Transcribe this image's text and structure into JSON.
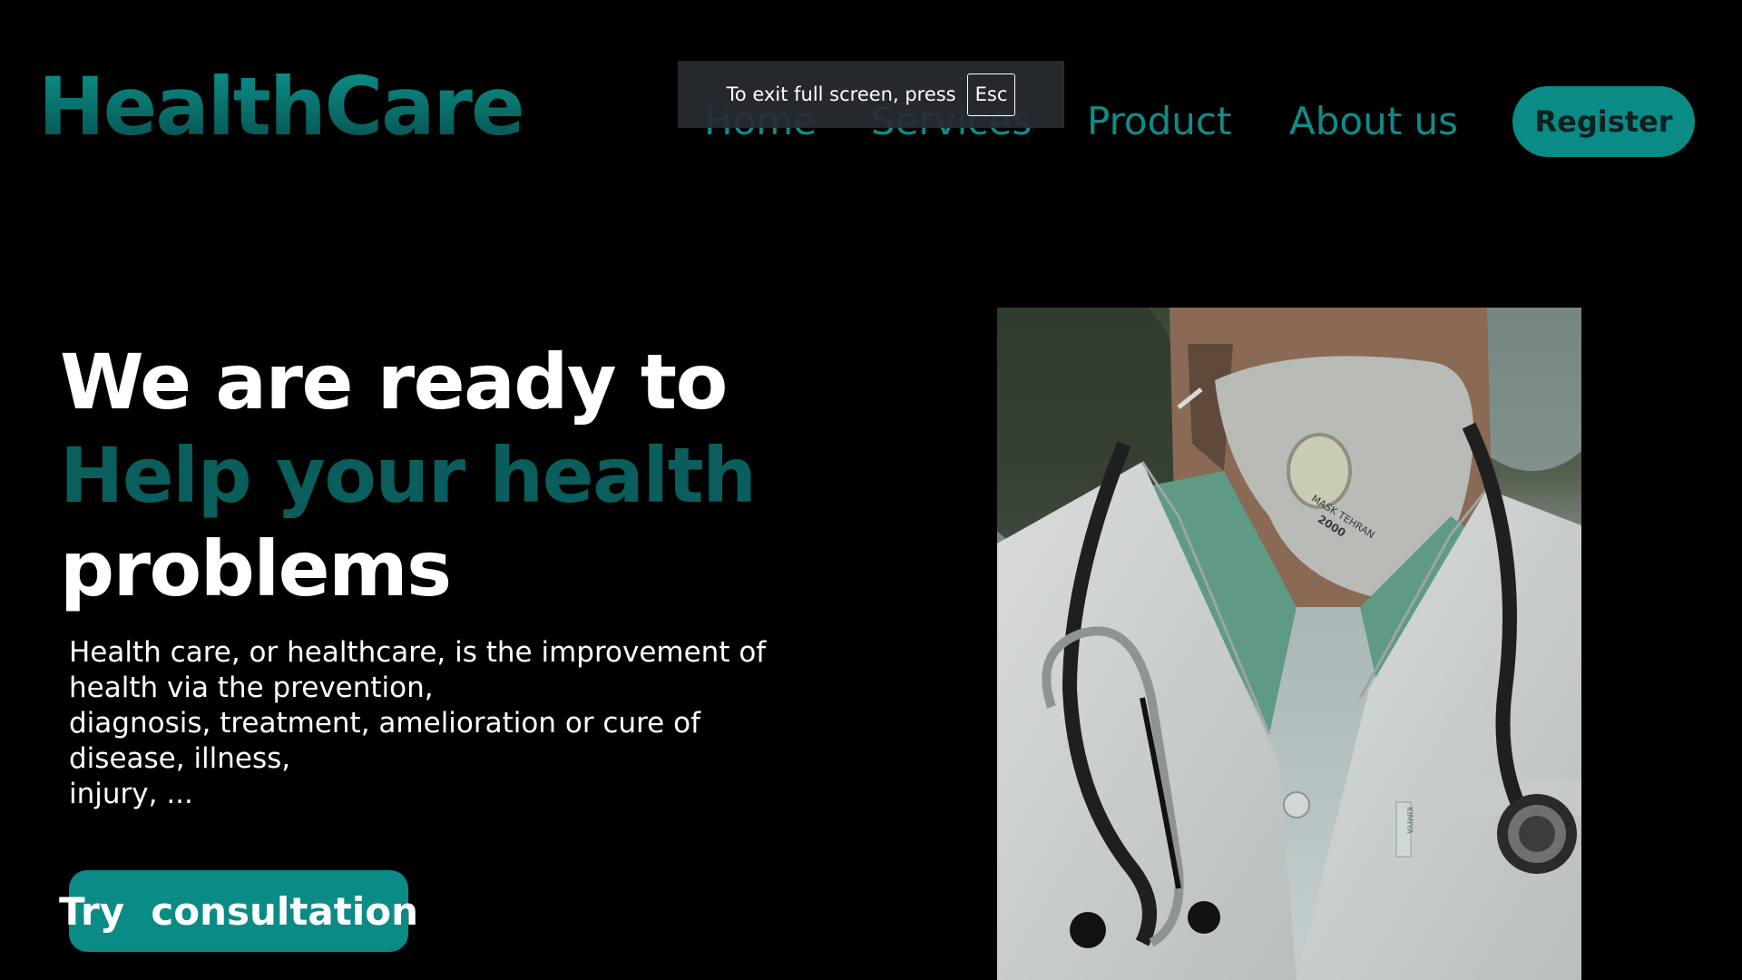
{
  "header": {
    "logo": "HealthCare",
    "nav": [
      "Home",
      "Services",
      "Product",
      "About us"
    ],
    "register_label": "Register"
  },
  "fullscreen_notice": {
    "message": "To exit full screen, press",
    "key": "Esc"
  },
  "hero": {
    "headline_line1": "We are ready to",
    "headline_line2": "Help your health",
    "headline_line3": "problems",
    "description": "Health care, or healthcare, is the improvement of\nhealth via the prevention,\n diagnosis, treatment, amelioration or cure of\ndisease, illness,\n injury, ...",
    "cta_label": "Try  consultation"
  },
  "image": {
    "mask_print": "MASK TEHRAN",
    "mask_model": "2000",
    "coat_tag": "KIMIYA"
  },
  "colors": {
    "background": "#000000",
    "teal": "#0a8b86",
    "teal_dark": "#0a5e5c",
    "text": "#ffffff"
  }
}
